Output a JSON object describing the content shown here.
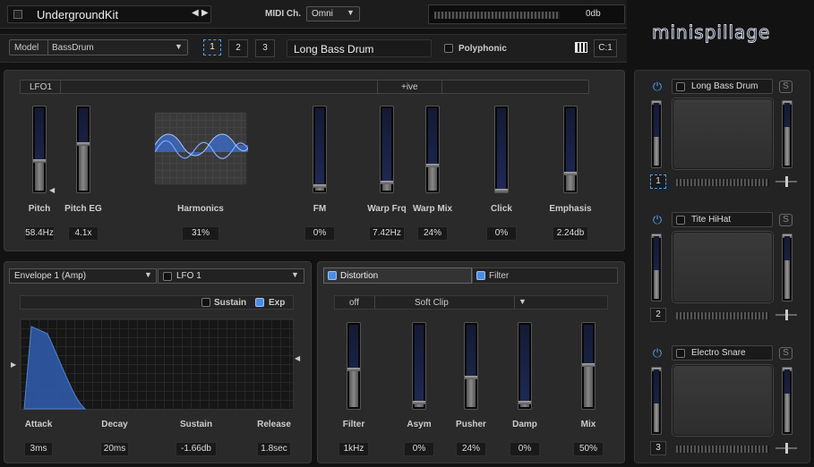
{
  "header": {
    "kit_name": "UndergroundKit",
    "midi_label": "MIDI Ch.",
    "midi_value": "Omni",
    "level_label": "0db",
    "logo": "minispillage"
  },
  "model_bar": {
    "model_label": "Model",
    "model_value": "BassDrum",
    "layers": [
      "1",
      "2",
      "3"
    ],
    "sound_name": "Long Bass Drum",
    "polyphonic_label": "Polyphonic",
    "channel": "C:1"
  },
  "synth": {
    "lfo_label": "LFO1",
    "lfo_mode": "+ive",
    "controls": [
      {
        "label": "Pitch",
        "value": "58.4Hz",
        "level": 0.35
      },
      {
        "label": "Pitch EG",
        "value": "4.1x",
        "level": 0.55
      },
      {
        "label": "Harmonics",
        "value": "31%"
      },
      {
        "label": "FM",
        "value": "0%",
        "level": 0.05
      },
      {
        "label": "Warp Frq",
        "value": "7.42Hz",
        "level": 0.1
      },
      {
        "label": "Warp Mix",
        "value": "24%",
        "level": 0.3
      },
      {
        "label": "Click",
        "value": "0%",
        "level": 0.0
      },
      {
        "label": "Emphasis",
        "value": "2.24db",
        "level": 0.2
      }
    ]
  },
  "envelope": {
    "source": "Envelope 1 (Amp)",
    "target": "LFO 1",
    "sustain_label": "Sustain",
    "exp_label": "Exp",
    "params": [
      {
        "label": "Attack",
        "value": "3ms"
      },
      {
        "label": "Decay",
        "value": "20ms"
      },
      {
        "label": "Sustain",
        "value": "-1.66db"
      },
      {
        "label": "Release",
        "value": "1.8sec"
      }
    ]
  },
  "effects": {
    "tab_distortion": "Distortion",
    "tab_filter": "Filter",
    "mode_value": "off",
    "clip_value": "Soft Clip",
    "params": [
      {
        "label": "Filter",
        "value": "1kHz",
        "level": 0.45
      },
      {
        "label": "Asym",
        "value": "0%",
        "level": 0.05
      },
      {
        "label": "Pusher",
        "value": "24%",
        "level": 0.35
      },
      {
        "label": "Damp",
        "value": "0%",
        "level": 0.05
      },
      {
        "label": "Mix",
        "value": "50%",
        "level": 0.5
      }
    ]
  },
  "pads": [
    {
      "name": "Long Bass Drum",
      "number": "1",
      "solo": "S"
    },
    {
      "name": "Tite HiHat",
      "number": "2",
      "solo": "S"
    },
    {
      "name": "Electro Snare",
      "number": "3",
      "solo": "S"
    }
  ],
  "colors": {
    "accent": "#4d8ce0",
    "fader_track": "#1f2a55",
    "background": "#121212"
  }
}
